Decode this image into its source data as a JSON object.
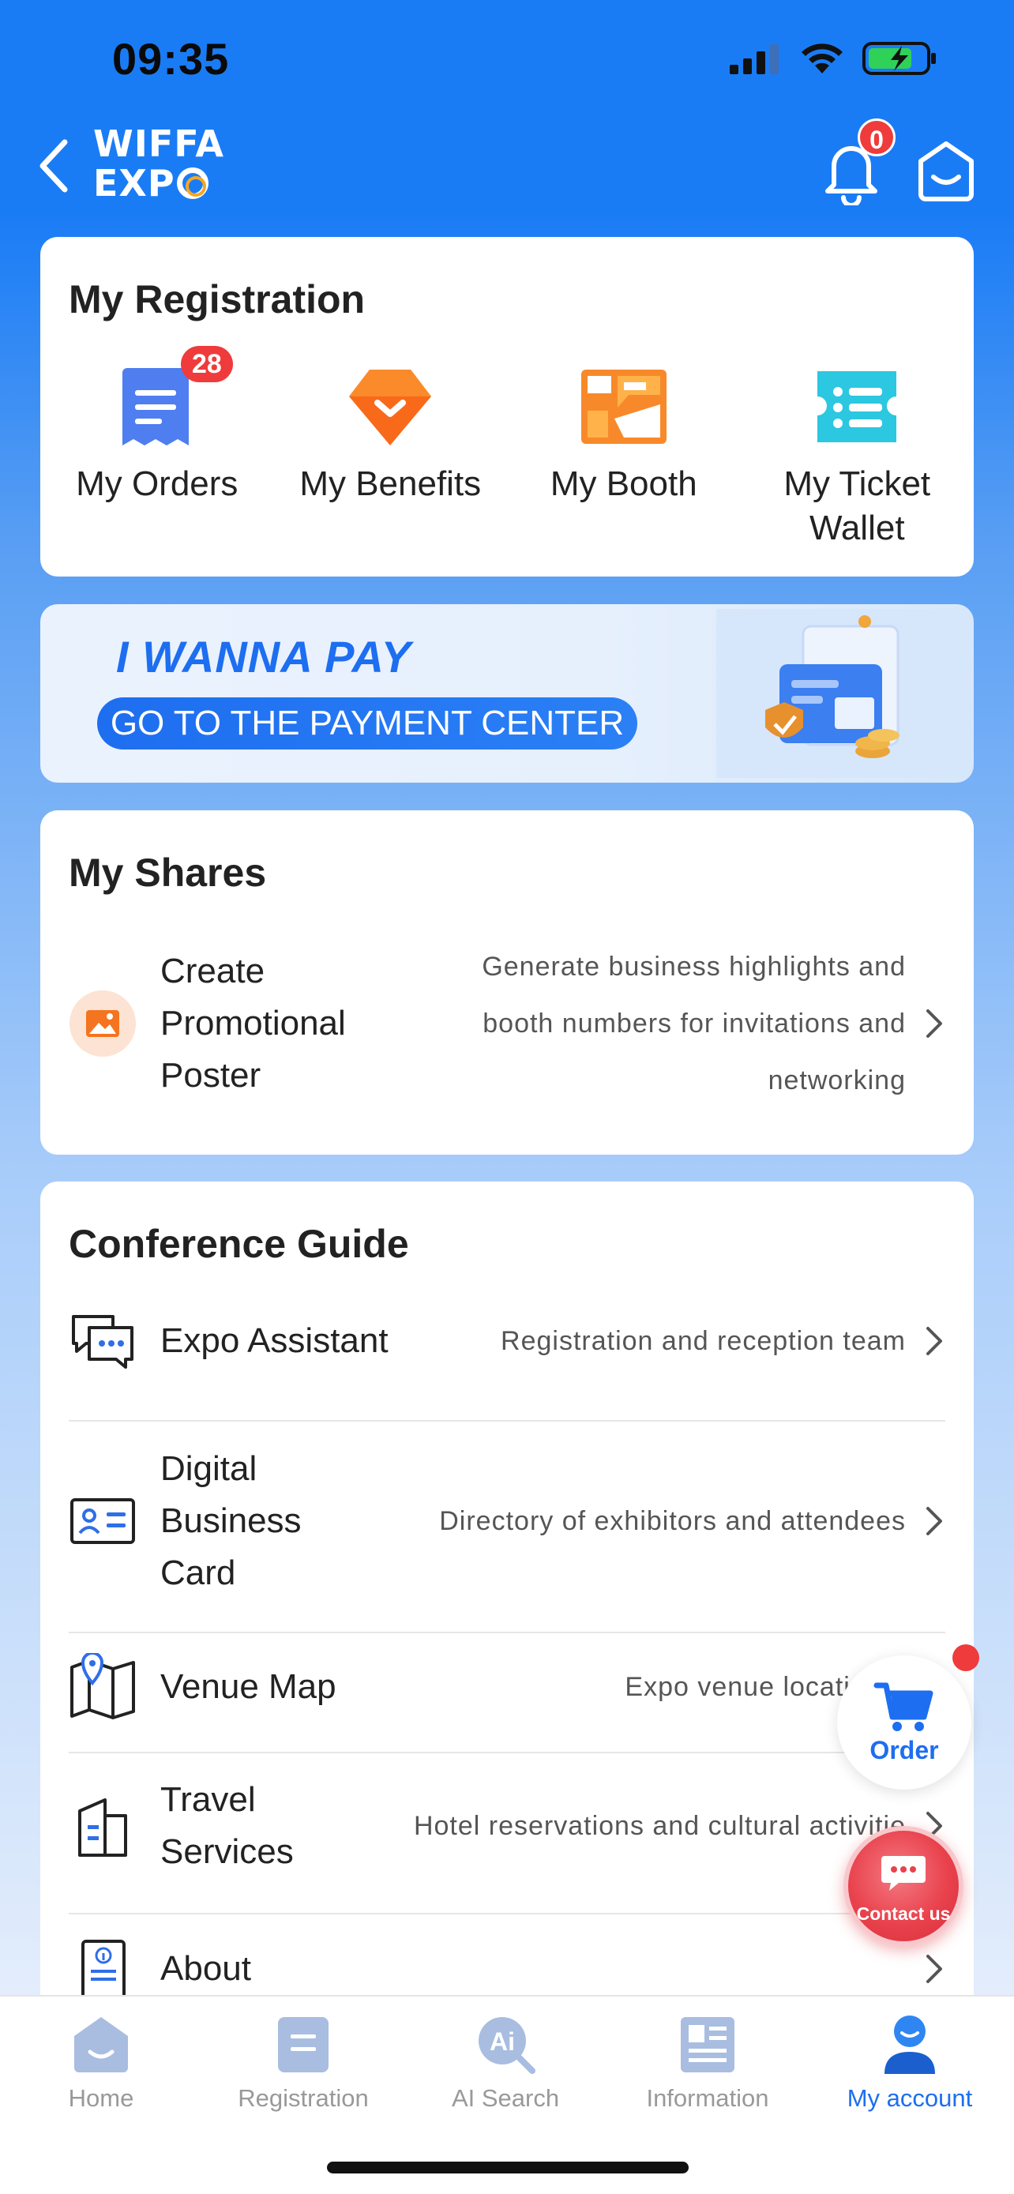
{
  "status_bar": {
    "time": "09:35"
  },
  "header": {
    "logo_line1": "WIFFA",
    "logo_line2": "EXP",
    "notification_count": "0"
  },
  "registration": {
    "title": "My Registration",
    "items": [
      {
        "label": "My Orders",
        "badge": "28",
        "icon": "orders-icon"
      },
      {
        "label": "My Benefits",
        "icon": "benefits-icon"
      },
      {
        "label": "My Booth",
        "icon": "booth-icon"
      },
      {
        "label": "My Ticket Wallet",
        "icon": "ticket-wallet-icon"
      }
    ]
  },
  "payment_banner": {
    "title": "I WANNA PAY",
    "button_label": "GO TO THE PAYMENT CENTER"
  },
  "shares": {
    "title": "My Shares",
    "items": [
      {
        "title": "Create Promotional Poster",
        "description": "Generate business highlights and booth numbers for invitations and networking"
      }
    ]
  },
  "guide": {
    "title": "Conference Guide",
    "items": [
      {
        "title": "Expo Assistant",
        "description": "Registration and reception team"
      },
      {
        "title": "Digital Business Card",
        "description": "Directory of exhibitors and attendees"
      },
      {
        "title": "Venue Map",
        "description": "Expo venue location n"
      },
      {
        "title": "Travel Services",
        "description": "Hotel reservations and cultural activitie"
      },
      {
        "title": "About",
        "description": ""
      }
    ]
  },
  "floating": {
    "order_label": "Order",
    "contact_label": "Contact us"
  },
  "tabbar": {
    "items": [
      {
        "label": "Home",
        "active": false
      },
      {
        "label": "Registration",
        "active": false
      },
      {
        "label": "AI Search",
        "active": false
      },
      {
        "label": "Information",
        "active": false
      },
      {
        "label": "My account",
        "active": true
      }
    ]
  },
  "colors": {
    "primary": "#1d6ef0",
    "header_bg": "#1a7cf5",
    "badge": "#ef3b3b",
    "inactive_tab": "#999999"
  }
}
